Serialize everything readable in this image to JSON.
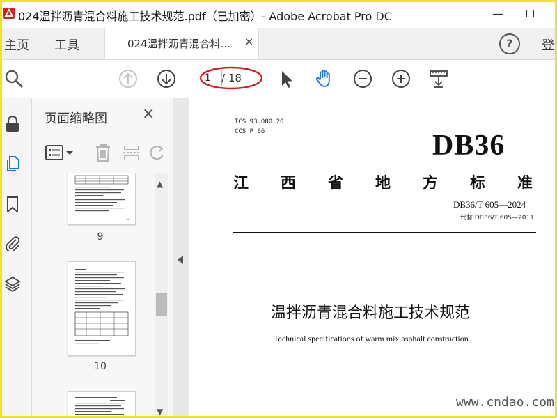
{
  "window": {
    "title": "024温拌沥青混合料施工技术规范.pdf（已加密）- Adobe Acrobat Pro DC"
  },
  "menu": {
    "home": "主页",
    "tools": "工具"
  },
  "tab": {
    "label": "024温拌沥青混合料...",
    "close": "×"
  },
  "account": {
    "help": "?",
    "login": "登"
  },
  "toolbar": {
    "page_current": "1",
    "page_total": "/ 18"
  },
  "thumbnails": {
    "title": "页面缩略图",
    "close": "×",
    "pages": [
      {
        "label": "9"
      },
      {
        "label": "10"
      }
    ]
  },
  "document": {
    "ics": "ICS 93.080.20",
    "ccs": "CCS P 66",
    "code": "DB36",
    "province_chars": [
      "江",
      "西",
      "省",
      "地",
      "方",
      "标",
      "准"
    ],
    "standard_number": "DB36/T 605—2024",
    "replaces": "代替 DB36/T 605—2011",
    "title_zh": "温拌沥青混合料施工技术规范",
    "title_en": "Technical specifications of warm mix asphalt construction"
  },
  "watermark": "www.cndao.com",
  "colors": {
    "frame": "#f6e21a",
    "annotation": "#d42020",
    "accent": "#1473e6"
  }
}
